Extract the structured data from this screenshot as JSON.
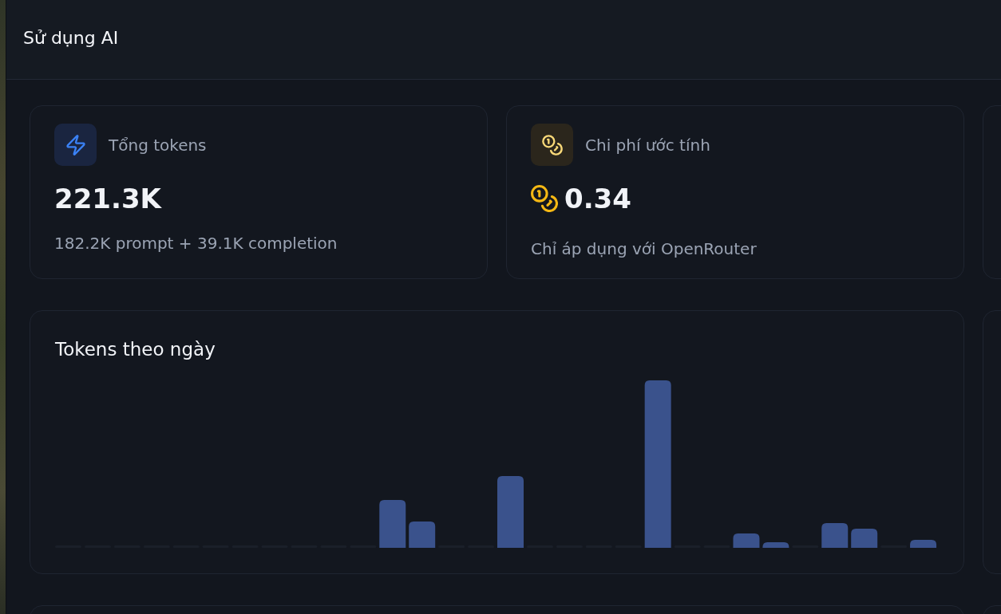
{
  "page": {
    "title": "Sử dụng AI"
  },
  "stat_cards": [
    {
      "kind": "tokens",
      "label": "Tổng tokens",
      "value": "221.3K",
      "detail": "182.2K prompt + 39.1K completion"
    },
    {
      "kind": "cost",
      "label": "Chi phí ước tính",
      "value": "0.34",
      "detail": "Chỉ áp dụng với OpenRouter"
    }
  ],
  "chart_card": {
    "title": "Tokens theo ngày"
  }
}
